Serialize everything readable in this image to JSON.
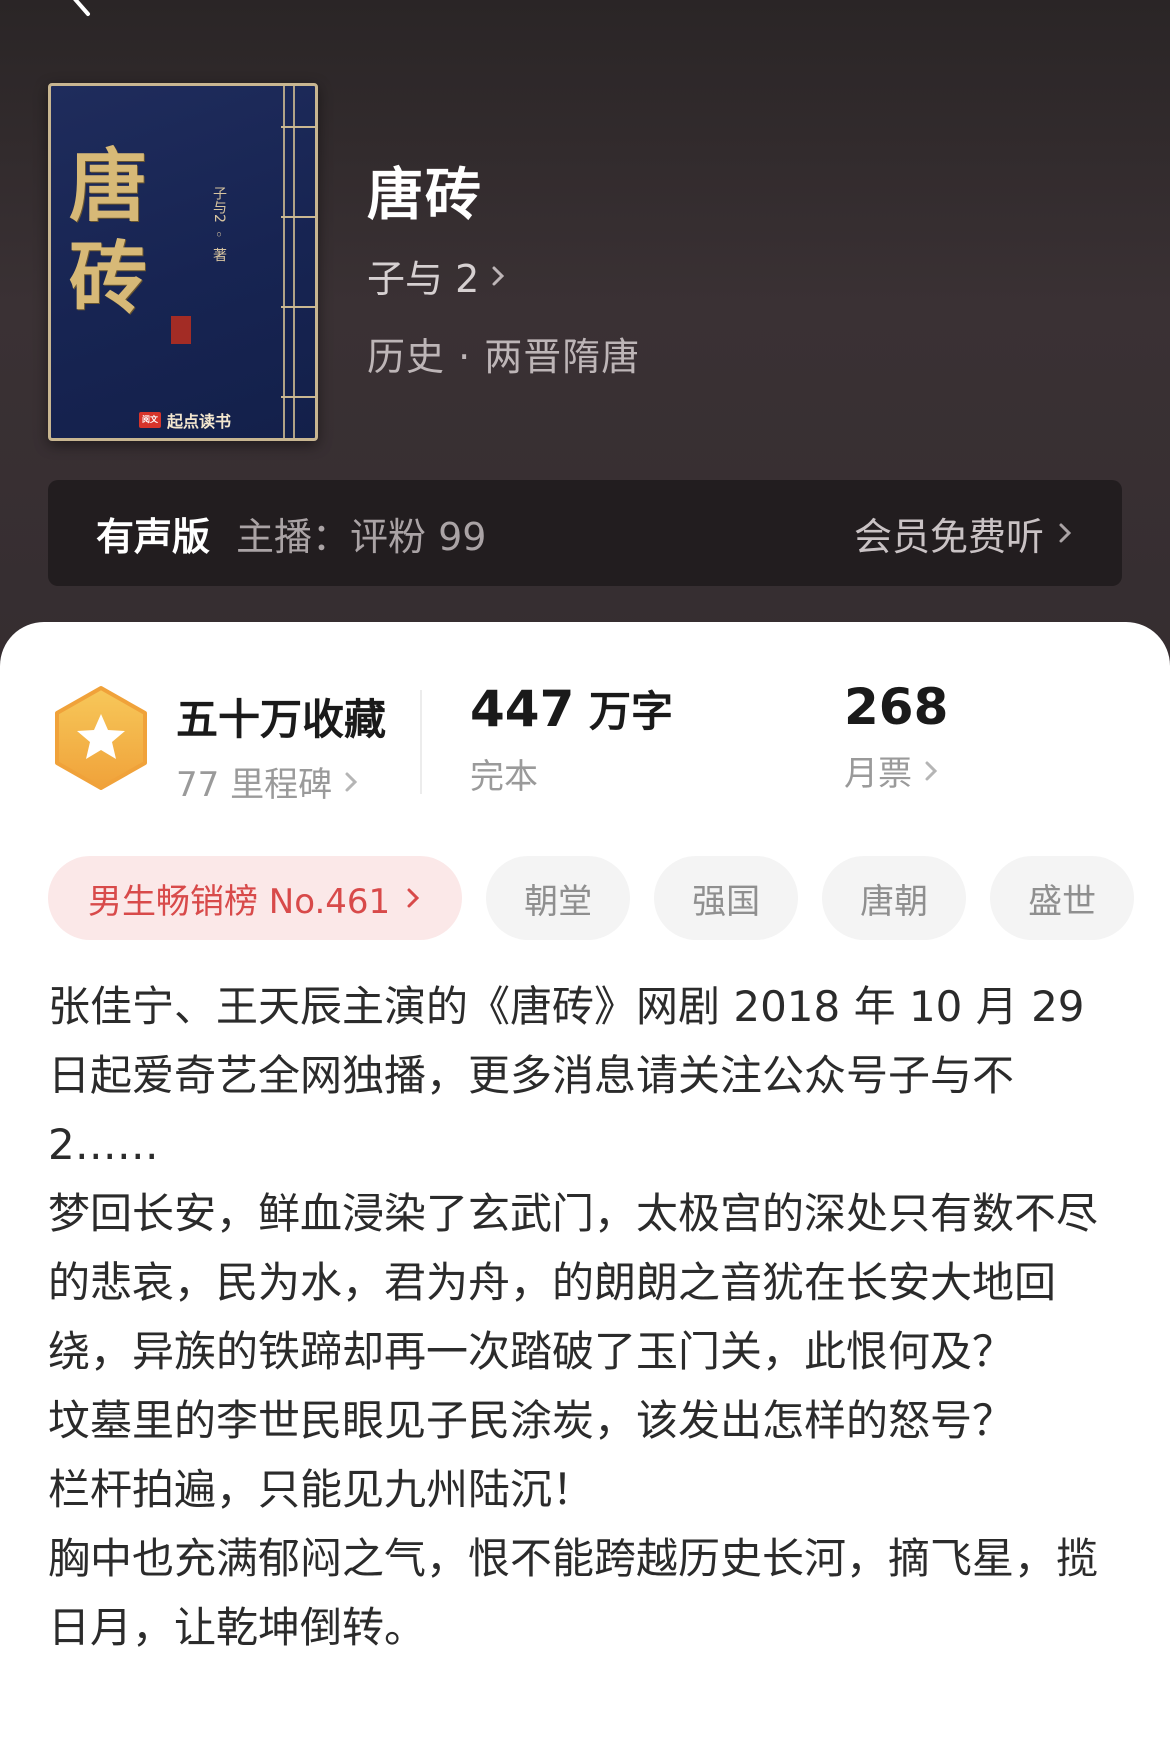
{
  "book": {
    "title": "唐砖",
    "author": "子与 2",
    "genre": "历史 · 两晋隋唐",
    "cover": {
      "title": "唐砖",
      "author_text": "子与2 ◦ 著",
      "publisher": "起点读书",
      "publisher_mark": "阅文"
    }
  },
  "audio": {
    "tag": "有声版",
    "host": "主播：评粉 99",
    "action": "会员免费听"
  },
  "stats": {
    "collections": "五十万收藏",
    "milestone": "77 里程碑",
    "word_count_num": "447",
    "word_count_unit": "万字",
    "status": "完本",
    "monthly_votes": "268",
    "monthly_votes_label": "月票"
  },
  "tags": {
    "rank": "男生畅销榜 No.461",
    "items": [
      "朝堂",
      "强国",
      "唐朝",
      "盛世"
    ]
  },
  "synopsis": {
    "p1": "张佳宁、王天辰主演的《唐砖》网剧 2018 年 10 月 29 日起爱奇艺全网独播，更多消息请关注公众号子与不 2……",
    "p2": "梦回长安，鲜血浸染了玄武门，太极宫的深处只有数不尽的悲哀，民为水，君为舟，的朗朗之音犹在长安大地回绕，异族的铁蹄却再一次踏破了玉门关，此恨何及？",
    "p3": "坟墓里的李世民眼见子民涂炭，该发出怎样的怒号？",
    "p4": "栏杆拍遍，只能见九州陆沉！",
    "p5": "胸中也充满郁闷之气，恨不能跨越历史长河，摘飞星，揽日月，让乾坤倒转。"
  },
  "colors": {
    "header_bg": "#352d30",
    "accent_red": "#d84a4a",
    "badge_gold": "#f4b94a"
  }
}
